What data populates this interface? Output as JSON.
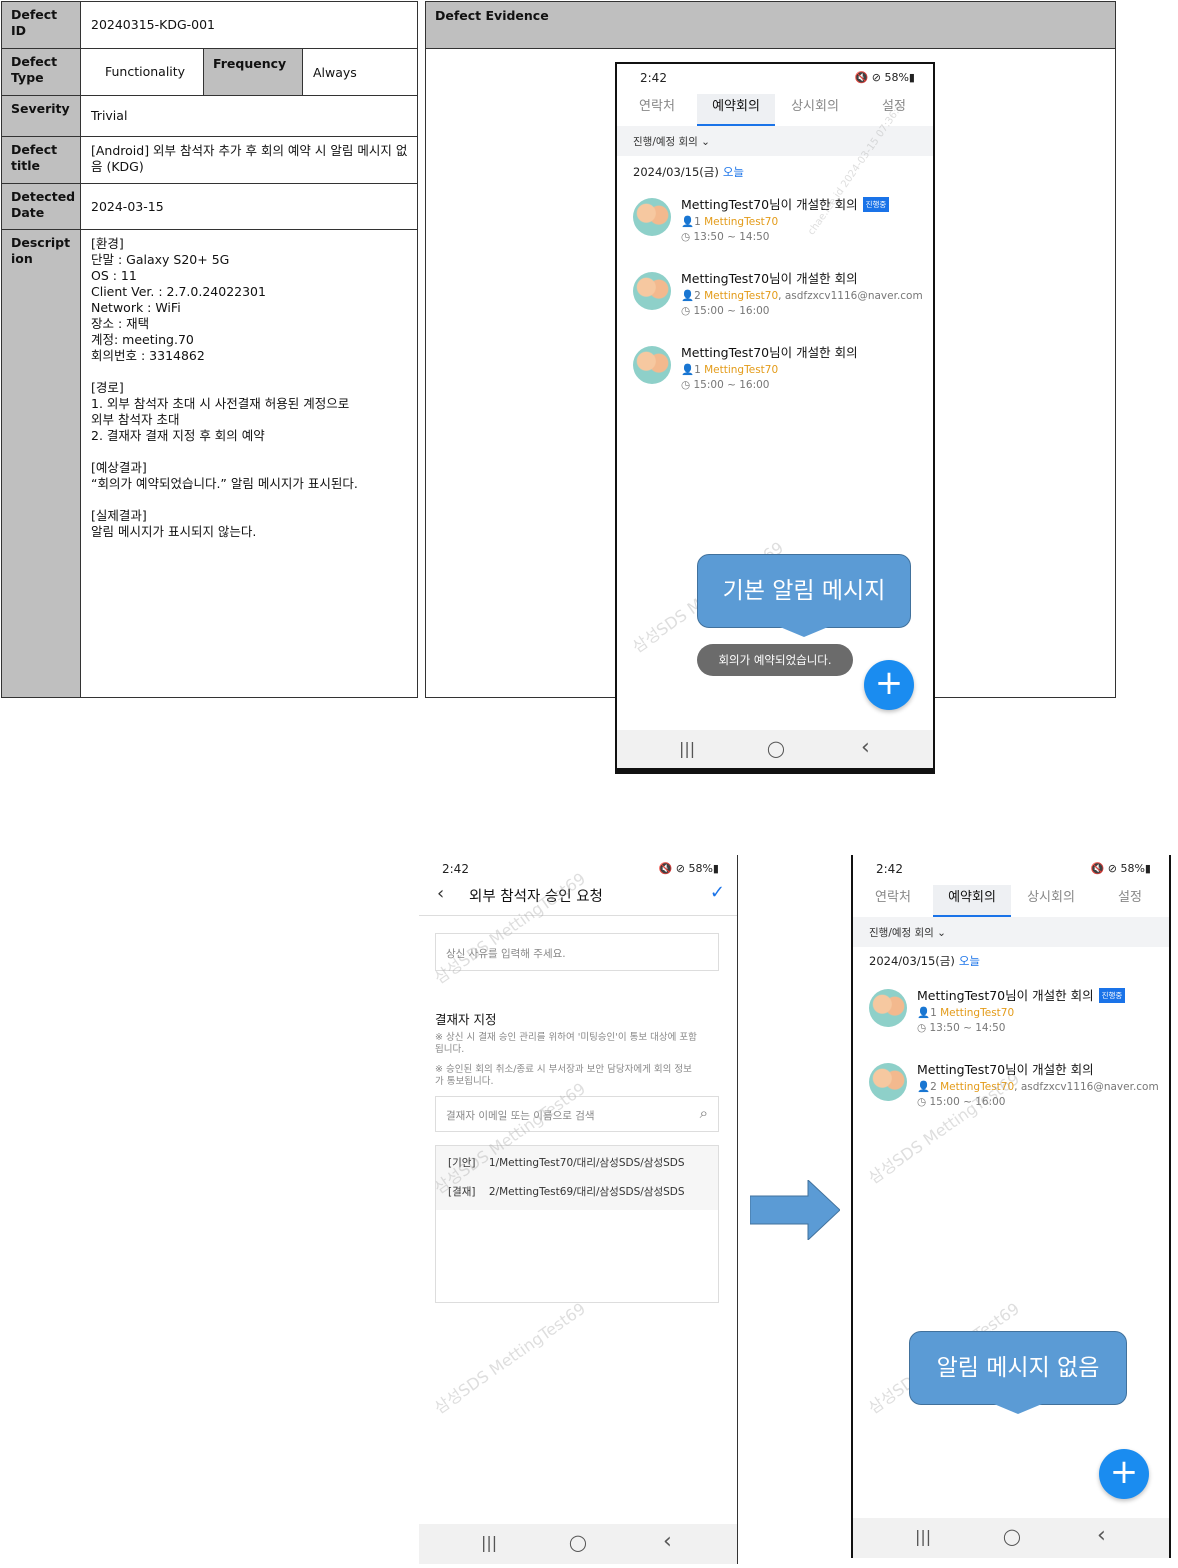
{
  "table": {
    "defect_id_label": "Defect ID",
    "defect_id": "20240315-KDG-001",
    "defect_type_label": "Defect Type",
    "defect_type": "Functionality",
    "frequency_label": "Frequency",
    "frequency": "Always",
    "severity_label": "Severity",
    "severity": "Trivial",
    "title_label": "Defect title",
    "title": "[Android] 외부 참석자 추가 후 회의 예약 시 알림 메시지 없음 (KDG)",
    "detected_label": "Detected Date",
    "detected": "2024-03-15",
    "description_label": "Description",
    "description": "[환경]\n단말 : Galaxy S20+ 5G\nOS : 11\nClient Ver. : 2.7.0.24022301\nNetwork : WiFi\n장소 : 재택\n계정: meeting.70\n회의번호 : 3314862\n\n[경로]\n1.   외부 참석자 초대 시 사전결재 허용된 계정으로\n      외부 참석자 초대\n2.   결재자 결재 지정 후 회의 예약\n\n[예상결과]\n“회의가 예약되었습니다.” 알림 메시지가 표시된다.\n\n[실제결과]\n알림 메시지가 표시되지 않는다."
  },
  "evidence": {
    "header": "Defect Evidence"
  },
  "phone": {
    "time": "2:42",
    "status_icons": "🔇 ⊘ 58%▮",
    "tabs": [
      "연락처",
      "예약회의",
      "상시회의",
      "설정"
    ],
    "filter": "진행/예정 회의 ⌄",
    "date": "2024/03/15(금)",
    "today": "오늘",
    "meetings": [
      {
        "title": "MettingTest70님이 개설한 회의",
        "badge": "진행중",
        "count": "1",
        "org": "MettingTest70",
        "extra": "",
        "time": "13:50 ~ 14:50"
      },
      {
        "title": "MettingTest70님이 개설한 회의",
        "badge": "",
        "count": "2",
        "org": "MettingTest70",
        "extra": ", asdfzxcv1116@naver.com",
        "time": "15:00 ~ 16:00"
      },
      {
        "title": "MettingTest70님이 개설한 회의",
        "badge": "",
        "count": "1",
        "org": "MettingTest70",
        "extra": "",
        "time": "15:00 ~ 16:00"
      }
    ],
    "fab": "+",
    "nav": [
      "|||",
      "◯",
      "‹"
    ],
    "watermark": "삼성SDS MettingTest69",
    "watermark2": "chae.lee.id 2024-03-15 07:36:0"
  },
  "callout1": "기본 알림 메시지",
  "toast": "회의가 예약되었습니다.",
  "approval": {
    "title": "외부 참석자 승인 요청",
    "reason_placeholder": "상신 사유를 입력해 주세요.",
    "section": "결재자 지정",
    "note1": "※ 상신 시 결재 승인 관리를 위하여 '미팅승인'이 통보 대상에 포함됩니다.",
    "note2": "※ 승인된 회의 취소/종료 시 부서장과 보안 담당자에게 회의 정보가 통보됩니다.",
    "search_placeholder": "결재자 이메일 또는 이름으로 검색",
    "approvers": [
      {
        "role": "[기안]",
        "name": "1/MettingTest70/대리/삼성SDS/삼성SDS"
      },
      {
        "role": "[결재]",
        "name": "2/MettingTest69/대리/삼성SDS/삼성SDS"
      }
    ]
  },
  "callout2": "알림 메시지 없음",
  "colors": {
    "accent": "#1a73e8",
    "callout": "#5b9bd5",
    "header_gray": "#bfbfbf",
    "org": "#e39b19"
  }
}
